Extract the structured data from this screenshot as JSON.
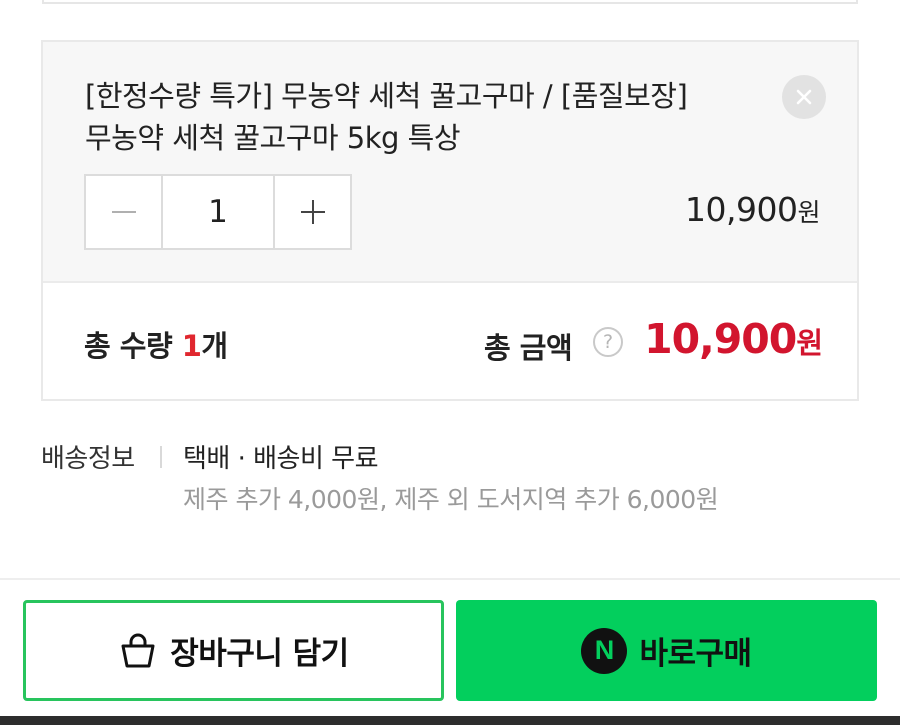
{
  "option": {
    "name": "[한정수량 특가] 무농약 세척 꿀고구마 / [품질보장] 무농약 세척 꿀고구마 5kg 특상",
    "remove_icon": "close-icon",
    "quantity": "1",
    "minus_icon": "minus-icon",
    "plus_icon": "plus-icon",
    "price": "10,900",
    "price_unit": "원"
  },
  "summary": {
    "total_qty_label": "총 수량 ",
    "total_qty_value": "1",
    "total_qty_unit": "개",
    "total_amount_label": "총 금액",
    "help_icon": "?",
    "total_amount": "10,900",
    "total_amount_unit": "원"
  },
  "delivery": {
    "label": "배송정보",
    "method": "택배 · 배송비 무료",
    "extra": "제주 추가 4,000원, 제주 외 도서지역 추가 6,000원"
  },
  "actions": {
    "cart_label": "장바구니 담기",
    "cart_icon": "shopping-bag-icon",
    "buy_label": "바로구매",
    "buy_badge": "N"
  },
  "colors": {
    "accent_red": "#d2152e",
    "brand_green": "#03cf5d",
    "border_green": "#28c45d"
  }
}
